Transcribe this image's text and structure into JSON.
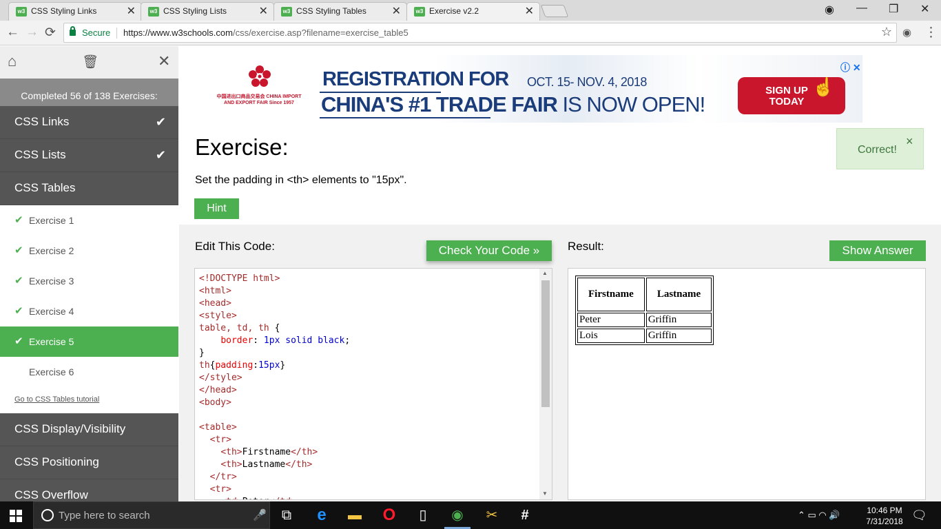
{
  "browser": {
    "tabs": [
      {
        "title": "CSS Styling Links",
        "active": false
      },
      {
        "title": "CSS Styling Lists",
        "active": false
      },
      {
        "title": "CSS Styling Tables",
        "active": false
      },
      {
        "title": "Exercise v2.2",
        "active": true
      }
    ],
    "favicon_text": "w3",
    "close_glyph": "✕",
    "secure_label": "Secure",
    "url_host": "https://www.w3schools.com",
    "url_path": "/css/exercise.asp?filename=exercise_table5",
    "back_glyph": "←",
    "forward_glyph": "→",
    "reload_glyph": "⟳",
    "star_glyph": "☆",
    "menu_glyph": "⋮",
    "profile_glyph": "◉",
    "minimize_glyph": "—",
    "restore_glyph": "❐",
    "window_close_glyph": "✕"
  },
  "sidebar": {
    "home_glyph": "⌂",
    "trash_glyph": "🗑",
    "close_glyph": "✕",
    "progress": "Completed 56 of 138 Exercises:",
    "check_glyph": "✔",
    "categories_top": [
      {
        "label": "CSS Links",
        "done": true
      },
      {
        "label": "CSS Lists",
        "done": true
      },
      {
        "label": "CSS Tables",
        "done": false
      }
    ],
    "exercises": [
      {
        "label": "Exercise 1",
        "done": true,
        "active": false
      },
      {
        "label": "Exercise 2",
        "done": true,
        "active": false
      },
      {
        "label": "Exercise 3",
        "done": true,
        "active": false
      },
      {
        "label": "Exercise 4",
        "done": true,
        "active": false
      },
      {
        "label": "Exercise 5",
        "done": true,
        "active": true
      },
      {
        "label": "Exercise 6",
        "done": false,
        "active": false
      }
    ],
    "tutorial_link": "Go to CSS Tables tutorial",
    "categories_bottom": [
      "CSS Display/Visibility",
      "CSS Positioning",
      "CSS Overflow"
    ]
  },
  "ad": {
    "logo_text": "中国进出口商品交易会 CHINA IMPORT AND EXPORT FAIR Since 1957",
    "line1": "REGISTRATION FOR",
    "dates": "OCT. 15- NOV. 4, 2018",
    "line2_bold": "CHINA'S #1 TRADE FAIR",
    "line2_rest": " IS NOW OPEN!",
    "cta": "SIGN UP TODAY",
    "adchoices": "ⓘ ✕",
    "hand_glyph": "☝"
  },
  "exercise": {
    "heading": "Exercise:",
    "instruction": "Set the padding in <th> elements to \"15px\".",
    "hint_label": "Hint",
    "correct_label": "Correct!",
    "correct_close": "×",
    "edit_label": "Edit This Code:",
    "check_label": "Check Your Code »",
    "result_label": "Result:",
    "show_answer_label": "Show Answer"
  },
  "code_lines": [
    "<!DOCTYPE html>",
    "<html>",
    "<head>",
    "<style>",
    "table, td, th {",
    "    border: 1px solid black;",
    "}",
    "th{padding:15px}",
    "</style>",
    "</head>",
    "<body>",
    "",
    "<table>",
    "  <tr>",
    "    <th>Firstname</th>",
    "    <th>Lastname</th>",
    "  </tr>",
    "  <tr>",
    "    <td>Peter</td>"
  ],
  "result_table": {
    "headers": [
      "Firstname",
      "Lastname"
    ],
    "rows": [
      [
        "Peter",
        "Griffin"
      ],
      [
        "Lois",
        "Griffin"
      ]
    ]
  },
  "taskbar": {
    "search_placeholder": "Type here to search",
    "tray": "⌃  ▭  ◠  🔊",
    "time": "10:46 PM",
    "date": "7/31/2018",
    "notif_glyph": "🗨"
  }
}
